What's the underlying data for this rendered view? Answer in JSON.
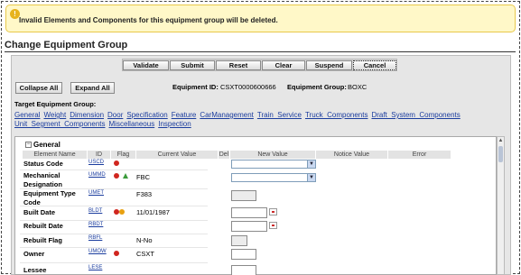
{
  "warning": {
    "icon": "info-icon",
    "message": "Invalid Elements and Components for this equipment group will be deleted."
  },
  "page_title": "Change Equipment Group",
  "toolbar": {
    "validate": "Validate",
    "submit": "Submit",
    "reset": "Reset",
    "clear": "Clear",
    "suspend": "Suspend",
    "cancel": "Cancel"
  },
  "actions": {
    "collapse_all": "Collapse All",
    "expand_all": "Expand All"
  },
  "header": {
    "equipment_id_label": "Equipment ID:",
    "equipment_id": "CSXT0000600666",
    "equipment_group_label": "Equipment Group:",
    "equipment_group": "BOXC"
  },
  "target_group": {
    "label": "Target Equipment Group:",
    "links": [
      "General",
      "Weight",
      "Dimension",
      "Door",
      "Specification",
      "Feature",
      "CarManagement",
      "Train_Service",
      "Truck_Components",
      "Draft_System_Components",
      "Unit_Segment_Components",
      "Miscellaneous",
      "Inspection"
    ]
  },
  "section": {
    "toggle": "−",
    "title": "General"
  },
  "columns": {
    "element_name": "Element Name",
    "id": "ID",
    "flag": "Flag",
    "current_value": "Current Value",
    "del": "Del",
    "new_value": "New Value",
    "notice_value": "Notice Value",
    "error": "Error"
  },
  "rows": [
    {
      "name": "Status Code",
      "id": "USCD",
      "current": ""
    },
    {
      "name": "Mechanical Designation",
      "id": "UMMD",
      "current": "FBC"
    },
    {
      "name": "Equipment Type Code",
      "id": "UMET",
      "current": "F383"
    },
    {
      "name": "Built Date",
      "id": "BLDT",
      "current": "11/01/1987"
    },
    {
      "name": "Rebuilt Date",
      "id": "RBDT",
      "current": ""
    },
    {
      "name": "Rebuilt Flag",
      "id": "RBFL",
      "current": "N-No"
    },
    {
      "name": "Owner",
      "id": "UMOW",
      "current": "CSXT"
    },
    {
      "name": "Lessee",
      "id": "LESE",
      "current": ""
    }
  ],
  "colors": {
    "link": "#1a3c9e",
    "flag_red": "#d0261f",
    "flag_orange": "#e8a010",
    "flag_green": "#3b9b3b",
    "warning_bg": "#fff8c8"
  }
}
